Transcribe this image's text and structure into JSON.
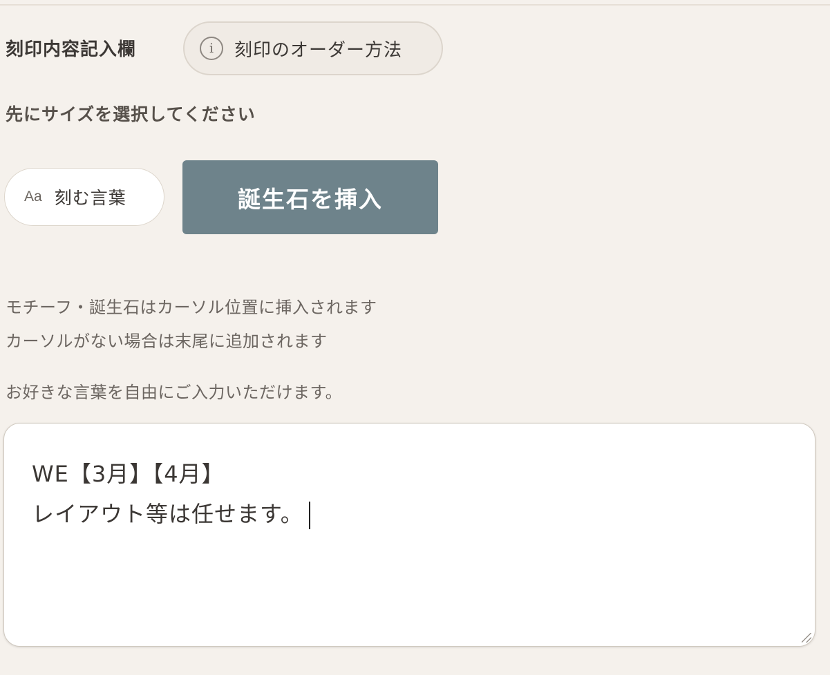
{
  "engraving": {
    "section_title": "刻印内容記入欄",
    "order_method_button": {
      "icon": "info-icon",
      "icon_glyph": "i",
      "label": "刻印のオーダー方法"
    },
    "instruction": "先にサイズを選択してください",
    "words_button": {
      "icon": "Aa",
      "label": "刻む言葉"
    },
    "birthstone_button": {
      "label": "誕生石を挿入",
      "color": "#6e838b"
    },
    "notes": [
      "モチーフ・誕生石はカーソル位置に挿入されます",
      "カーソルがない場合は末尾に追加されます",
      "お好きな言葉を自由にご入力いただけます。"
    ],
    "textarea": {
      "lines": [
        "WE【3月】【4月】",
        "レイアウト等は任せます。"
      ]
    }
  }
}
